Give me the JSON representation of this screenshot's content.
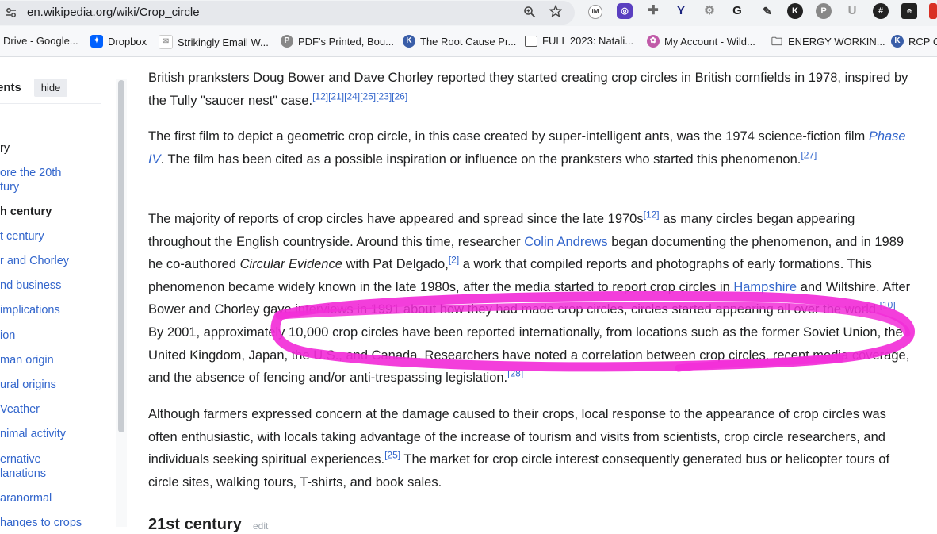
{
  "browser": {
    "url": "en.wikipedia.org/wiki/Crop_circle",
    "bookmarks": [
      {
        "label": "Drive - Google...",
        "icon": "google-drive-icon"
      },
      {
        "label": "Dropbox",
        "icon": "dropbox-icon"
      },
      {
        "label": "Strikingly Email W...",
        "icon": "mail-icon"
      },
      {
        "label": "PDF's Printed, Bou...",
        "icon": "pdf-icon"
      },
      {
        "label": "The Root Cause Pr...",
        "icon": "k-icon"
      },
      {
        "label": "FULL 2023: Natali...",
        "icon": "page-icon"
      },
      {
        "label": "My Account - Wild...",
        "icon": "flower-icon"
      },
      {
        "label": "ENERGY WORKIN...",
        "icon": "folder-icon"
      },
      {
        "label": "RCP C",
        "icon": "k-icon"
      }
    ]
  },
  "sidebar": {
    "title": "ents",
    "hide_label": "hide",
    "items": [
      {
        "label": "ry"
      },
      {
        "label": "ore the 20th"
      },
      {
        "label": "tury"
      },
      {
        "label": "h century"
      },
      {
        "label": "t century"
      },
      {
        "label": "r and Chorley"
      },
      {
        "label": "nd business"
      },
      {
        "label": " implications"
      },
      {
        "label": "ion"
      },
      {
        "label": "man origin"
      },
      {
        "label": "ural origins"
      },
      {
        "label": "Veather"
      },
      {
        "label": "nimal activity"
      },
      {
        "label": "ernative"
      },
      {
        "label": "lanations"
      },
      {
        "label": "aranormal"
      },
      {
        "label": "hanges to crops"
      }
    ]
  },
  "article": {
    "p1": {
      "text": "British pranksters Doug Bower and Dave Chorley reported they started creating crop circles in British cornfields in 1978, inspired by the Tully \"saucer nest\" case.",
      "refs": "[12][21][24][25][23][26]"
    },
    "p2": {
      "t1": "The first film to depict a geometric crop circle, in this case created by super-intelligent ants, was the 1974 science-fiction film ",
      "link": "Phase IV",
      "t2": ". The film has been cited as a possible inspiration or influence on the pranksters who started this phenomenon.",
      "ref": "[27]"
    },
    "p3": {
      "t1": "The majority of reports of crop circles have appeared and spread since the late 1970s",
      "ref1": "[12]",
      "t2": " as many circles began appearing throughout the English countryside. Around this time, researcher ",
      "link1": "Colin Andrews",
      "t3": " began documenting the phenomenon, and in 1989 he co-authored ",
      "italic": "Circular Evidence",
      "t4": " with Pat Delgado,",
      "ref2": "[2]",
      "t5": " a work that compiled reports and photographs of early formations. This phenomenon became widely known in the late 1980s, after the media started to report crop circles in ",
      "link2": "Hampshire",
      "t6": " and Wiltshire. After Bower and Chorley gave interviews in 1991 about how they had made crop circles, circles started appearing all over the world.",
      "ref3": "[10]",
      "t7": " By 2001, approximately 10,000 crop circles have been reported internationally, from locations such as the former Soviet Union, the United Kingdom, Japan, the U.S., and Canada. Researchers have noted a correlation between crop circles, recent media coverage, and the absence of fencing and/or anti-trespassing legislation.",
      "ref4": "[28]"
    },
    "p4": {
      "text": "Although farmers expressed concern at the damage caused to their crops, local response to the appearance of crop circles was often enthusiastic, with locals taking advantage of the increase of tourism and visits from scientists, crop circle researchers, and individuals seeking spiritual experiences.",
      "ref": "[25]",
      "text2": " The market for crop circle interest consequently generated bus or helicopter tours of circle sites, walking tours, T-shirts, and book sales."
    },
    "heading": "21st century",
    "edit_label": "edit"
  },
  "colors": {
    "link": "#3366cc",
    "text": "#202122",
    "annotation": "#f22ed8"
  }
}
